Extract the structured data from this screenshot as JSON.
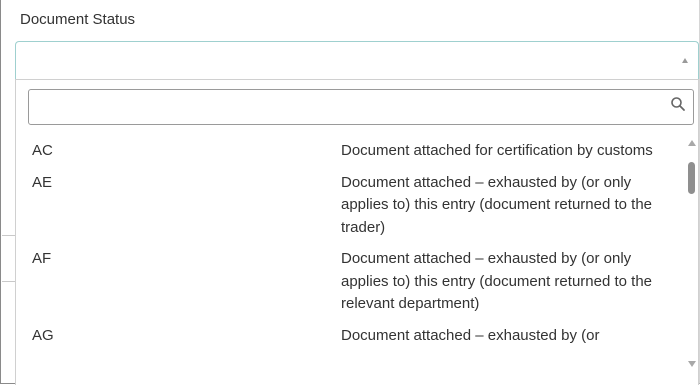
{
  "field": {
    "label": "Document Status",
    "selected_value": ""
  },
  "search": {
    "placeholder": "",
    "value": ""
  },
  "options": [
    {
      "code": "AC",
      "description": "Document attached for certification by customs"
    },
    {
      "code": "AE",
      "description": "Document attached – exhausted by (or only applies to) this entry (document returned to the trader)"
    },
    {
      "code": "AF",
      "description": "Document attached – exhausted by (or only applies to) this entry (document returned to the relevant department)"
    },
    {
      "code": "AG",
      "description": "Document attached – exhausted by (or"
    }
  ],
  "icons": {
    "search": "search-icon",
    "select_arrow": "chevron-up-icon",
    "scroll_up": "scroll-up-arrow-icon",
    "scroll_down": "scroll-down-arrow-icon"
  },
  "colors": {
    "focus_border": "#9fd0cf",
    "text": "#333333",
    "scroll_thumb": "#8f8f8f"
  }
}
